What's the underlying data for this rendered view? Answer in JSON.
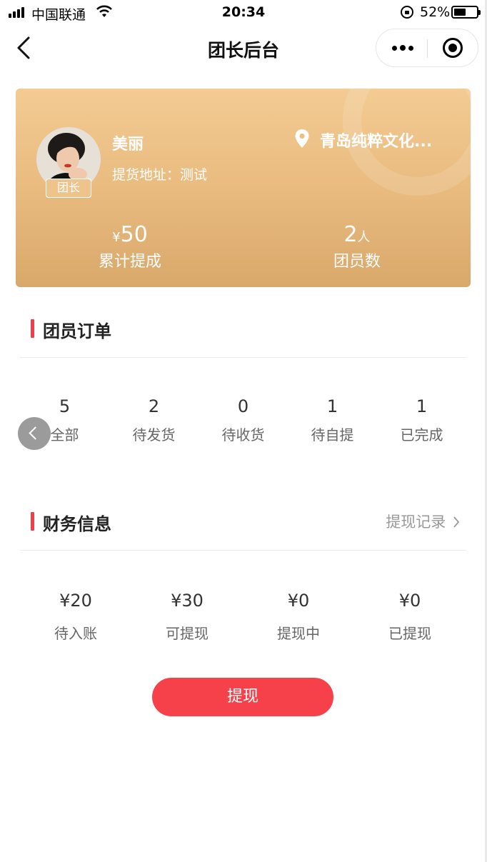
{
  "status_bar": {
    "carrier": "中国联通",
    "time": "20:34",
    "battery": "52%",
    "battery_level": 0.52
  },
  "nav": {
    "title": "团长后台",
    "icons": [
      "back-icon",
      "more-icon",
      "close-mini-program-icon"
    ]
  },
  "leader": {
    "name": "美丽",
    "badge": "团长",
    "pickup_address": "提货地址：测试",
    "shop_name": "青岛纯粹文化...",
    "commission_currency": "¥",
    "commission_value": "50",
    "commission_label": "累计提成",
    "members_value": "2",
    "members_unit": "人",
    "members_label": "团员数",
    "colors": {
      "card_top": "#f3cb93",
      "card_bottom": "#d9a86b"
    }
  },
  "orders": {
    "title": "团员订单",
    "items": [
      {
        "count": "5",
        "label": "全部"
      },
      {
        "count": "2",
        "label": "待发货"
      },
      {
        "count": "0",
        "label": "待收货"
      },
      {
        "count": "1",
        "label": "待自提"
      },
      {
        "count": "1",
        "label": "已完成"
      }
    ]
  },
  "finance": {
    "title": "财务信息",
    "link": "提现记录",
    "items": [
      {
        "value": "¥20",
        "label": "待入账"
      },
      {
        "value": "¥30",
        "label": "可提现"
      },
      {
        "value": "¥0",
        "label": "提现中"
      },
      {
        "value": "¥0",
        "label": "已提现"
      }
    ],
    "withdraw_button": "提现"
  },
  "colors": {
    "accent": "#f7414a",
    "section_bar": "#f33d48"
  }
}
